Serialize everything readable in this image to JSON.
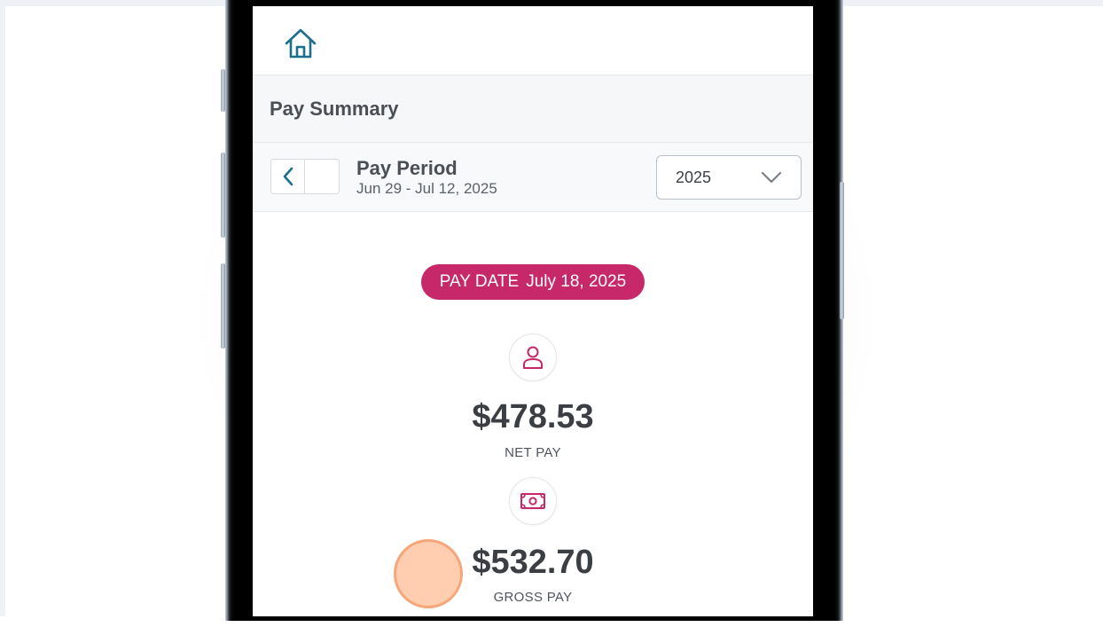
{
  "header": {
    "home_icon": "home-icon"
  },
  "section": {
    "title": "Pay Summary"
  },
  "period": {
    "label": "Pay Period",
    "range": "Jun 29 - Jul 12, 2025",
    "prev_icon": "chevron-left-icon"
  },
  "year_select": {
    "value": "2025",
    "icon": "chevron-down-icon"
  },
  "pay_date": {
    "label": "PAY DATE",
    "value": "July 18, 2025"
  },
  "net_pay": {
    "icon": "person-icon",
    "amount": "$478.53",
    "label": "NET PAY"
  },
  "gross_pay": {
    "icon": "money-icon",
    "amount": "$532.70",
    "label": "GROSS PAY"
  },
  "colors": {
    "accent": "#c6286a",
    "primary_icon": "#1c6f8c",
    "text_dark": "#3b3f44"
  }
}
